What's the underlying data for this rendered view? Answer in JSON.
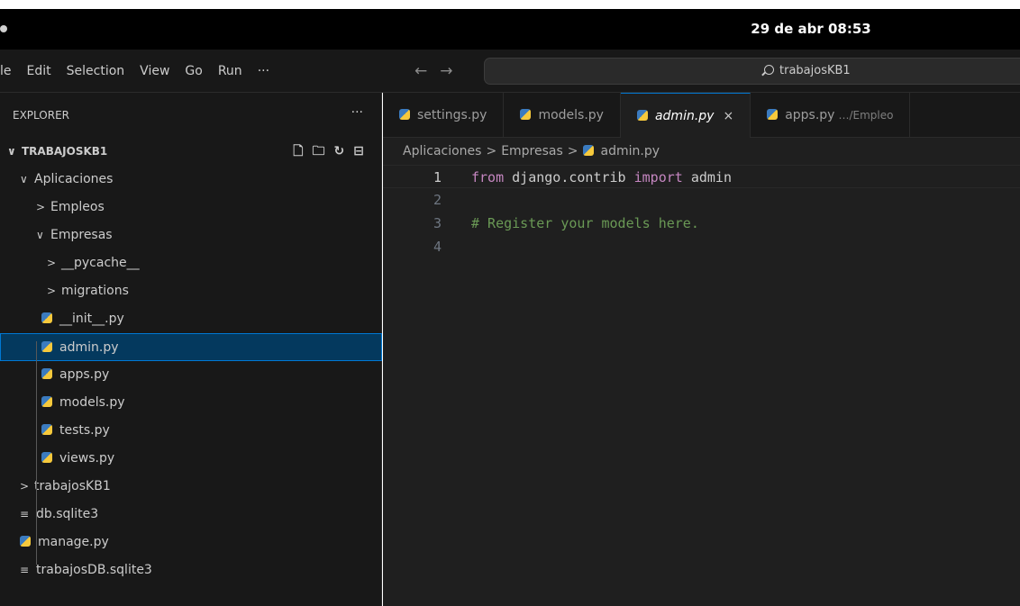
{
  "system": {
    "clock": "29 de abr  08:53"
  },
  "menu": [
    "le",
    "Edit",
    "Selection",
    "View",
    "Go",
    "Run",
    "···"
  ],
  "nav": {
    "back": "←",
    "forward": "→"
  },
  "search": {
    "text": "trabajosKB1"
  },
  "explorer": {
    "title": "EXPLORER",
    "more": "···",
    "root": "TRABAJOSKB1",
    "actions": [
      "new-file",
      "new-folder",
      "refresh",
      "collapse-all"
    ],
    "tree": [
      {
        "label": "Aplicaciones",
        "kind": "folder-open",
        "depth": 1
      },
      {
        "label": "Empleos",
        "kind": "folder-closed",
        "depth": 2
      },
      {
        "label": "Empresas",
        "kind": "folder-open",
        "depth": 2
      },
      {
        "label": "__pycache__",
        "kind": "folder-closed",
        "depth": 3
      },
      {
        "label": "migrations",
        "kind": "folder-closed",
        "depth": 3
      },
      {
        "label": "__init__.py",
        "kind": "python",
        "depth": 3
      },
      {
        "label": "admin.py",
        "kind": "python",
        "depth": 3,
        "selected": true
      },
      {
        "label": "apps.py",
        "kind": "python",
        "depth": 3
      },
      {
        "label": "models.py",
        "kind": "python",
        "depth": 3
      },
      {
        "label": "tests.py",
        "kind": "python",
        "depth": 3
      },
      {
        "label": "views.py",
        "kind": "python",
        "depth": 3
      },
      {
        "label": "trabajosKB1",
        "kind": "folder-closed",
        "depth": 1
      },
      {
        "label": "db.sqlite3",
        "kind": "db",
        "depth": 1
      },
      {
        "label": "manage.py",
        "kind": "python",
        "depth": 1
      },
      {
        "label": "trabajosDB.sqlite3",
        "kind": "db",
        "depth": 1
      }
    ]
  },
  "tabs": [
    {
      "label": "settings.py",
      "active": false
    },
    {
      "label": "models.py",
      "active": false
    },
    {
      "label": "admin.py",
      "active": true,
      "close": "×"
    },
    {
      "label": "apps.py",
      "active": false,
      "path": "…/Empleo"
    }
  ],
  "breadcrumb": {
    "parts": [
      "Aplicaciones",
      "Empresas",
      "admin.py"
    ],
    "sep": ">"
  },
  "code": [
    {
      "n": "1",
      "tokens": [
        [
          "kw",
          "from"
        ],
        [
          "",
          " django.contrib "
        ],
        [
          "kw",
          "import"
        ],
        [
          "",
          " admin"
        ]
      ]
    },
    {
      "n": "2",
      "tokens": []
    },
    {
      "n": "3",
      "tokens": [
        [
          "cm",
          "# Register your models here."
        ]
      ]
    },
    {
      "n": "4",
      "tokens": []
    }
  ],
  "colors": {
    "accent": "#0078d4",
    "selection": "#04395e",
    "keyword": "#c586c0",
    "comment": "#6a9955"
  }
}
